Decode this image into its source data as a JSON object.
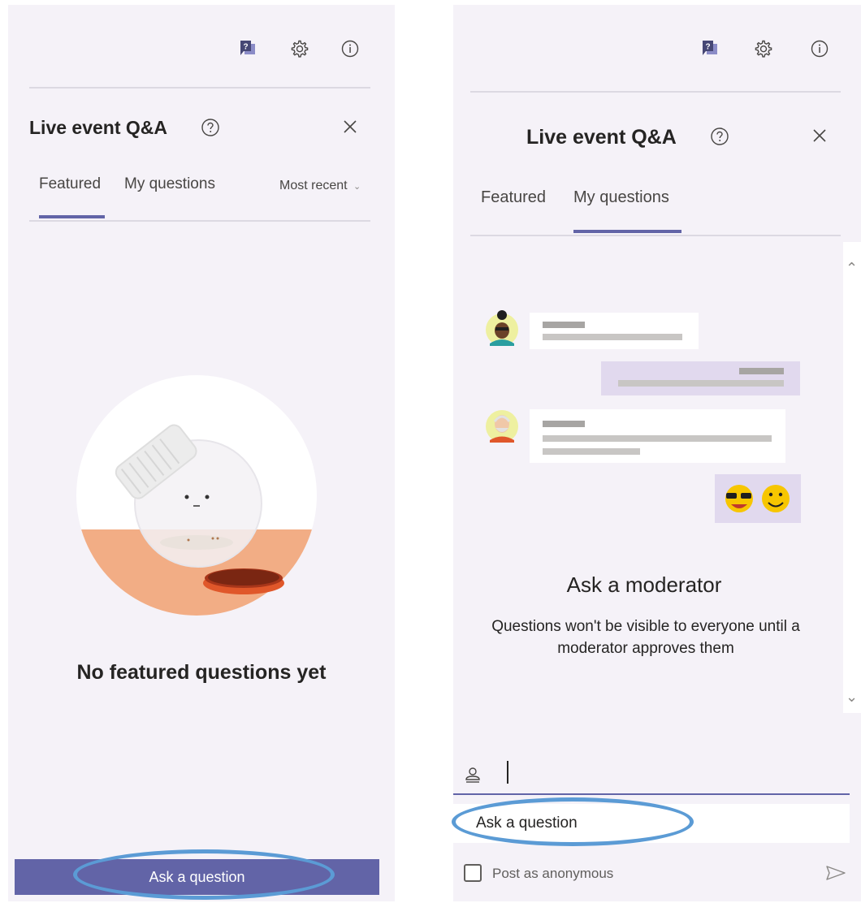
{
  "left_panel": {
    "toolbar": {
      "qa_icon": "qa-icon",
      "settings_icon": "gear-icon",
      "info_icon": "info-icon"
    },
    "title": "Live event Q&A",
    "help_icon": "question-circle-icon",
    "close_icon": "close-icon",
    "tabs": [
      {
        "label": "Featured",
        "active": true
      },
      {
        "label": "My questions",
        "active": false
      }
    ],
    "sort": {
      "label": "Most recent",
      "icon": "chevron-down-icon"
    },
    "empty_state": {
      "title": "No featured questions yet"
    },
    "ask_button": {
      "label": "Ask a question"
    }
  },
  "right_panel": {
    "toolbar": {
      "qa_icon": "qa-icon",
      "settings_icon": "gear-icon",
      "info_icon": "info-icon"
    },
    "title": "Live event Q&A",
    "help_icon": "question-circle-icon",
    "close_icon": "close-icon",
    "tabs": [
      {
        "label": "Featured",
        "active": false
      },
      {
        "label": "My questions",
        "active": true
      }
    ],
    "moderator": {
      "title": "Ask a moderator",
      "description": "Questions won't be visible to everyone until a moderator approves them"
    },
    "input": {
      "person_icon": "person-icon",
      "placeholder": "Ask a question",
      "anonymous_label": "Post as anonymous",
      "anonymous_checked": false,
      "send_icon": "send-icon"
    }
  },
  "colors": {
    "accent": "#6264a7",
    "panel_bg": "#f5f2f8",
    "highlight": "#5b9bd5",
    "jar_orange": "#f2ad85",
    "lid_orange": "#e0572a"
  }
}
